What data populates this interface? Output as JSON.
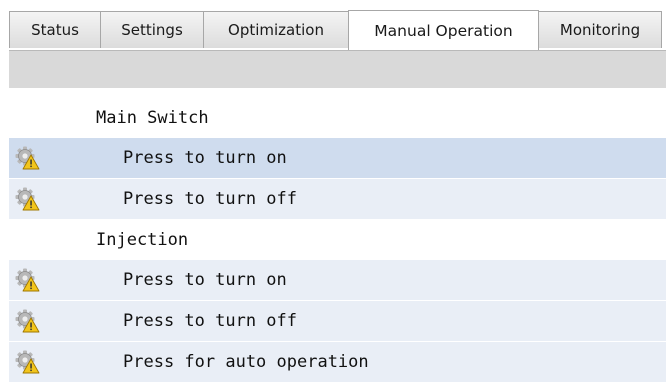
{
  "tabs": [
    {
      "label": "Status",
      "active": false
    },
    {
      "label": "Settings",
      "active": false
    },
    {
      "label": "Optimization",
      "active": false
    },
    {
      "label": "Manual Operation",
      "active": true
    },
    {
      "label": "Monitoring",
      "active": false
    }
  ],
  "groups": [
    {
      "title": "Main Switch",
      "actions": [
        {
          "label": "Press to turn on",
          "icon": "gear-warning-icon",
          "selected": true
        },
        {
          "label": "Press to turn off",
          "icon": "gear-warning-icon",
          "selected": false
        }
      ]
    },
    {
      "title": "Injection",
      "actions": [
        {
          "label": "Press to turn on",
          "icon": "gear-warning-icon",
          "selected": false
        },
        {
          "label": "Press to turn off",
          "icon": "gear-warning-icon",
          "selected": false
        },
        {
          "label": "Press for auto operation",
          "icon": "gear-warning-icon",
          "selected": false
        }
      ]
    }
  ],
  "colors": {
    "tab_border": "#a7a7a7",
    "strip": "#d9d9d9",
    "row": "#e9eef6",
    "row_selected": "#cfdcee",
    "warning_triangle": "#f2c51c",
    "gear": "#b8b8b8"
  }
}
